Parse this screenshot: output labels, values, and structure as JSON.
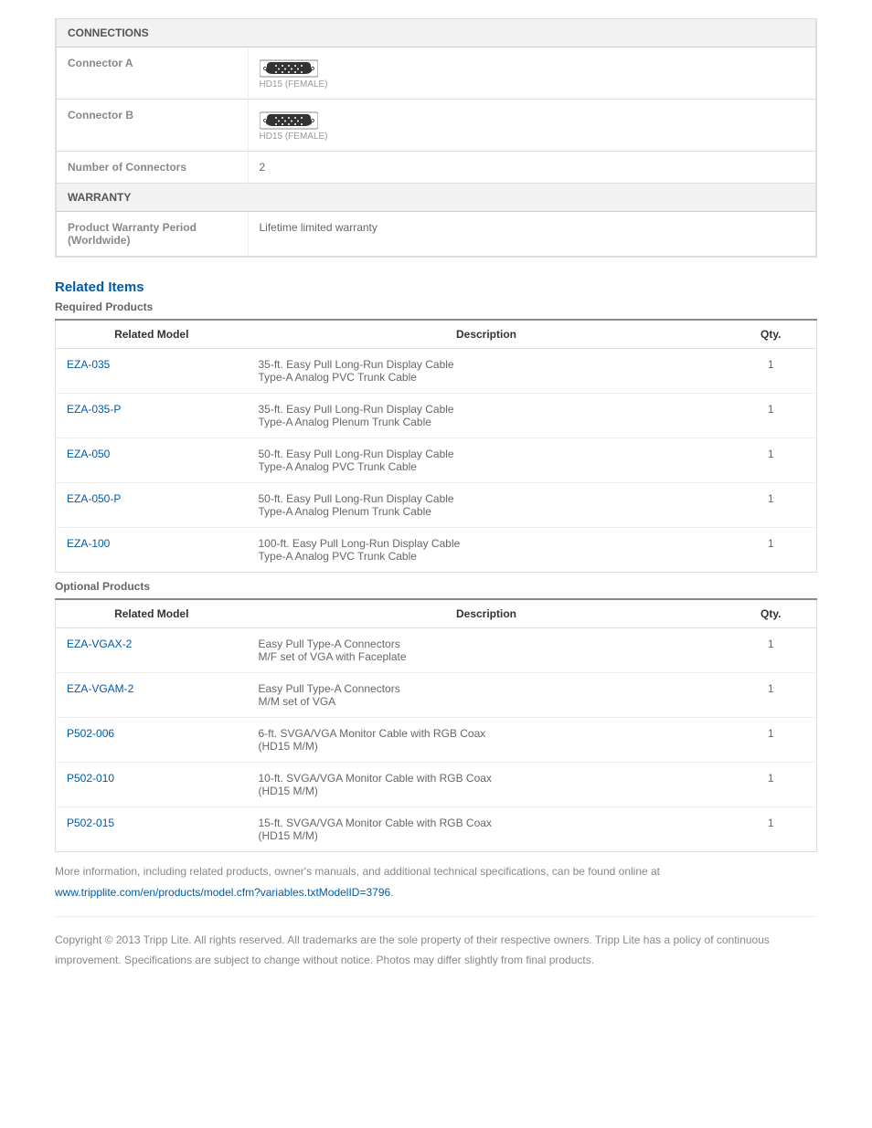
{
  "specs": {
    "connections_header": "CONNECTIONS",
    "connector_a_label": "Connector A",
    "connector_a_value": "HD15 (FEMALE)",
    "connector_b_label": "Connector B",
    "connector_b_value": "HD15 (FEMALE)",
    "num_conn_label": "Number of Connectors",
    "num_conn_value": "2",
    "warranty_header": "WARRANTY",
    "warranty_label": "Product Warranty Period (Worldwide)",
    "warranty_value": "Lifetime limited warranty"
  },
  "related": {
    "title": "Related Items",
    "required_title": "Required Products",
    "optional_title": "Optional Products",
    "col_model": "Related Model",
    "col_desc": "Description",
    "col_qty": "Qty.",
    "required": [
      {
        "model": "EZA-035",
        "desc1": "35-ft. Easy Pull Long-Run Display Cable",
        "desc2": "Type-A Analog PVC Trunk Cable",
        "qty": "1"
      },
      {
        "model": "EZA-035-P",
        "desc1": "35-ft. Easy Pull Long-Run Display Cable",
        "desc2": "Type-A Analog Plenum Trunk Cable",
        "qty": "1"
      },
      {
        "model": "EZA-050",
        "desc1": "50-ft. Easy Pull Long-Run Display Cable",
        "desc2": "Type-A Analog PVC Trunk Cable",
        "qty": "1"
      },
      {
        "model": "EZA-050-P",
        "desc1": "50-ft. Easy Pull Long-Run Display Cable",
        "desc2": "Type-A Analog Plenum Trunk Cable",
        "qty": "1"
      },
      {
        "model": "EZA-100",
        "desc1": "100-ft. Easy Pull Long-Run Display Cable",
        "desc2": "Type-A Analog PVC Trunk Cable",
        "qty": "1"
      }
    ],
    "optional": [
      {
        "model": "EZA-VGAX-2",
        "desc1": "Easy Pull Type-A Connectors",
        "desc2": "M/F set of VGA with Faceplate",
        "qty": "1"
      },
      {
        "model": "EZA-VGAM-2",
        "desc1": "Easy Pull Type-A Connectors",
        "desc2": "M/M set of VGA",
        "qty": "1"
      },
      {
        "model": "P502-006",
        "desc1": "6-ft. SVGA/VGA Monitor Cable with RGB Coax",
        "desc2": "(HD15 M/M)",
        "qty": "1"
      },
      {
        "model": "P502-010",
        "desc1": "10-ft. SVGA/VGA Monitor Cable with RGB Coax",
        "desc2": "(HD15 M/M)",
        "qty": "1"
      },
      {
        "model": "P502-015",
        "desc1": "15-ft. SVGA/VGA Monitor Cable with RGB Coax",
        "desc2": "(HD15 M/M)",
        "qty": "1"
      }
    ]
  },
  "footer": {
    "more_info_prefix": "More information, including related products, owner's manuals, and additional technical specifications, can be found online at ",
    "more_info_link": "www.tripplite.com/en/products/model.cfm?variables.txtModelID=3796",
    "more_info_suffix": ".",
    "copyright": "Copyright © 2013 Tripp Lite. All rights reserved. All trademarks are the sole property of their respective owners. Tripp Lite has a policy of continuous improvement. Specifications are subject to change without notice. Photos may differ slightly from final products."
  }
}
